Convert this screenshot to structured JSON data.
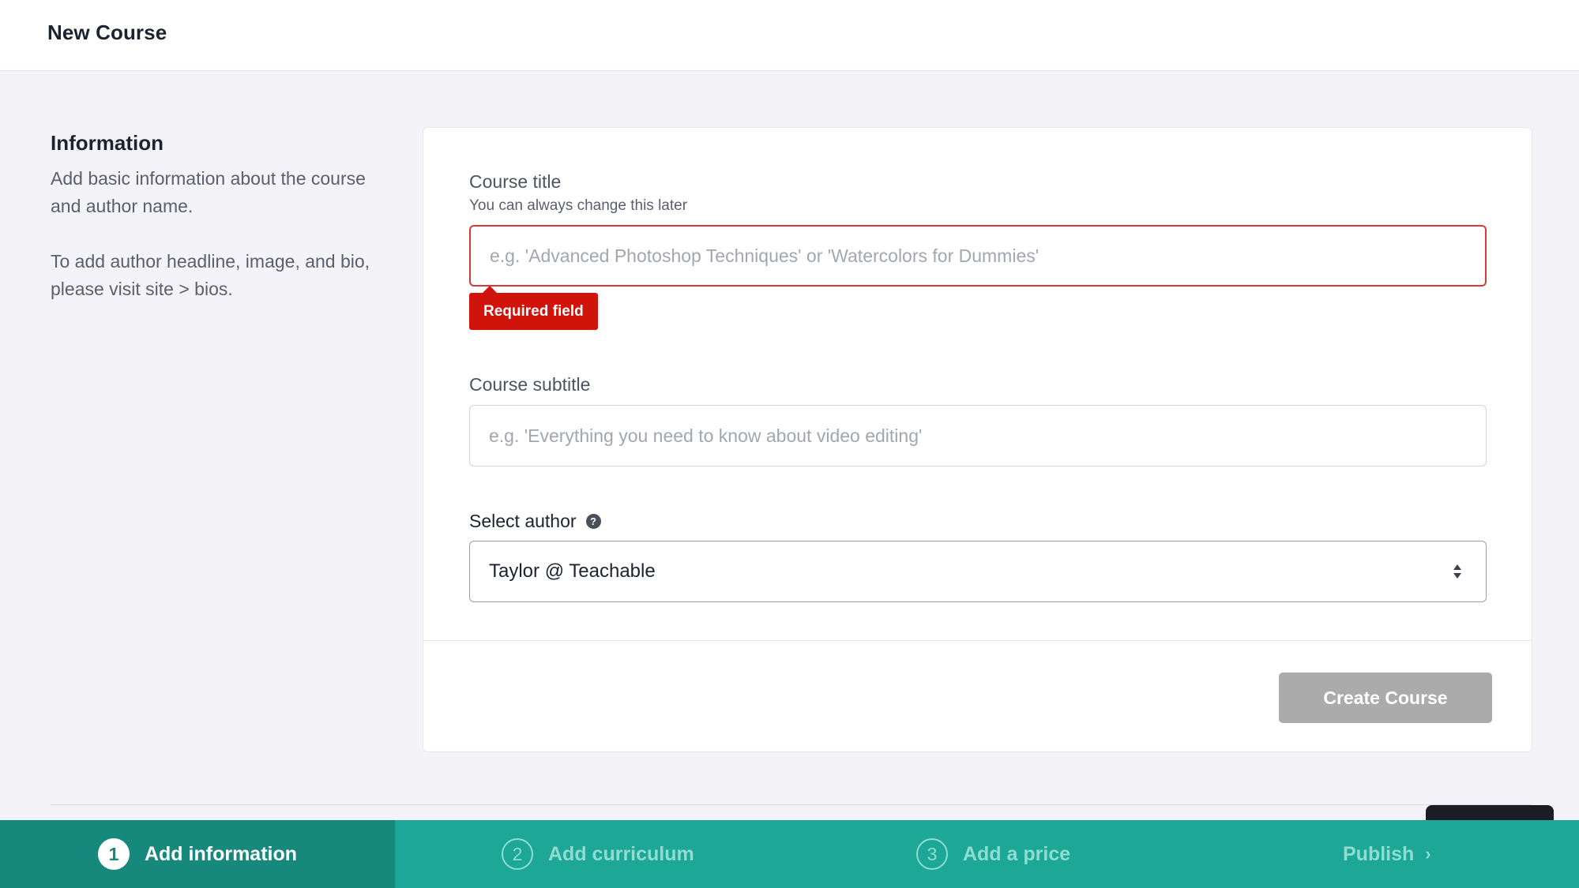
{
  "header": {
    "title": "New Course"
  },
  "info": {
    "heading": "Information",
    "paragraph1": "Add basic information about the course and author name.",
    "paragraph2": "To add author headline, image, and bio, please visit site > bios."
  },
  "form": {
    "title_label": "Course title",
    "title_hint": "You can always change this later",
    "title_placeholder": "e.g. 'Advanced Photoshop Techniques' or 'Watercolors for Dummies'",
    "title_error": "Required field",
    "subtitle_label": "Course subtitle",
    "subtitle_placeholder": "e.g. 'Everything you need to know about video editing'",
    "author_label": "Select author",
    "author_help_icon": "question-circle-icon",
    "author_value": "Taylor @ Teachable",
    "submit_label": "Create Course"
  },
  "colors": {
    "error": "#d0140b",
    "step_bar": "#1da797",
    "step_active": "#16887c",
    "button_disabled": "#ababab"
  },
  "steps": [
    {
      "number": "1",
      "label": "Add information",
      "active": true
    },
    {
      "number": "2",
      "label": "Add curriculum",
      "active": false
    },
    {
      "number": "3",
      "label": "Add a price",
      "active": false
    },
    {
      "number": "",
      "label": "Publish",
      "active": false,
      "icon": "chevron-right-icon"
    }
  ]
}
